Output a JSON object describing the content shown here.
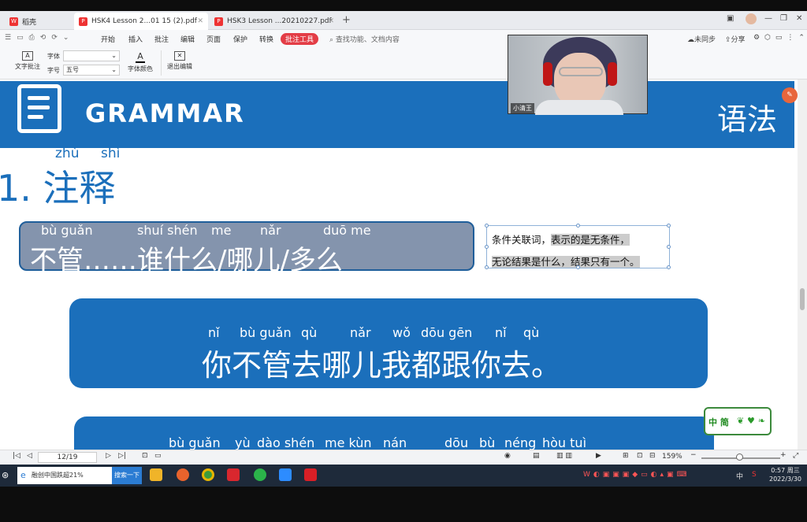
{
  "tabs": [
    {
      "label": "稻壳"
    },
    {
      "label": "HSK4 Lesson 2...01 15 (2).pdf"
    },
    {
      "label": "HSK3 Lesson ...20210227.pdf"
    }
  ],
  "menu": [
    "开始",
    "插入",
    "批注",
    "编辑",
    "页面",
    "保护",
    "转换"
  ],
  "menu_active": "批注工具",
  "search_placeholder": "查找功能、文档内容",
  "right_menu": {
    "sync": "未同步",
    "share": "分享"
  },
  "ribbon": {
    "text_comment": "文字批注",
    "font_label": "字体",
    "size_label": "字号",
    "size_value": "五号",
    "font_color": "字体颜色",
    "exit_edit": "退出编辑"
  },
  "slide": {
    "banner": "GRAMMAR",
    "banner_cn": "语法",
    "title": "1. 注释",
    "title_py": [
      "zhù",
      "shì"
    ],
    "pattern_py": [
      "bù guǎn",
      "shuí shén",
      "me",
      "nǎr",
      "duō me"
    ],
    "pattern": "不管……谁什么/哪儿/多么",
    "note_a": "条件关联词，",
    "note_b": "表示的是无条件，",
    "note_c": "无论结果是什么，结果只有一个。",
    "example1_py": [
      "nǐ",
      "bù guǎn",
      "qù",
      "nǎr",
      "wǒ",
      "dōu gēn",
      "nǐ",
      "qù"
    ],
    "example1": "你不管去哪儿我都跟你去。",
    "example2_py": [
      "bù guǎn",
      "yù",
      "dào shén",
      "me kùn",
      "nán",
      "dōu",
      "bù",
      "néng",
      "hòu tuì"
    ],
    "sticker": "中 简"
  },
  "status": {
    "page": "12/19",
    "zoom": "159%"
  },
  "taskbar": {
    "search_text": "融创中国跌超21%",
    "search_btn": "搜索一下",
    "ime": "中",
    "time": "0:57 周三",
    "date": "2022/3/30"
  },
  "webcam": {
    "name": "小清王"
  }
}
